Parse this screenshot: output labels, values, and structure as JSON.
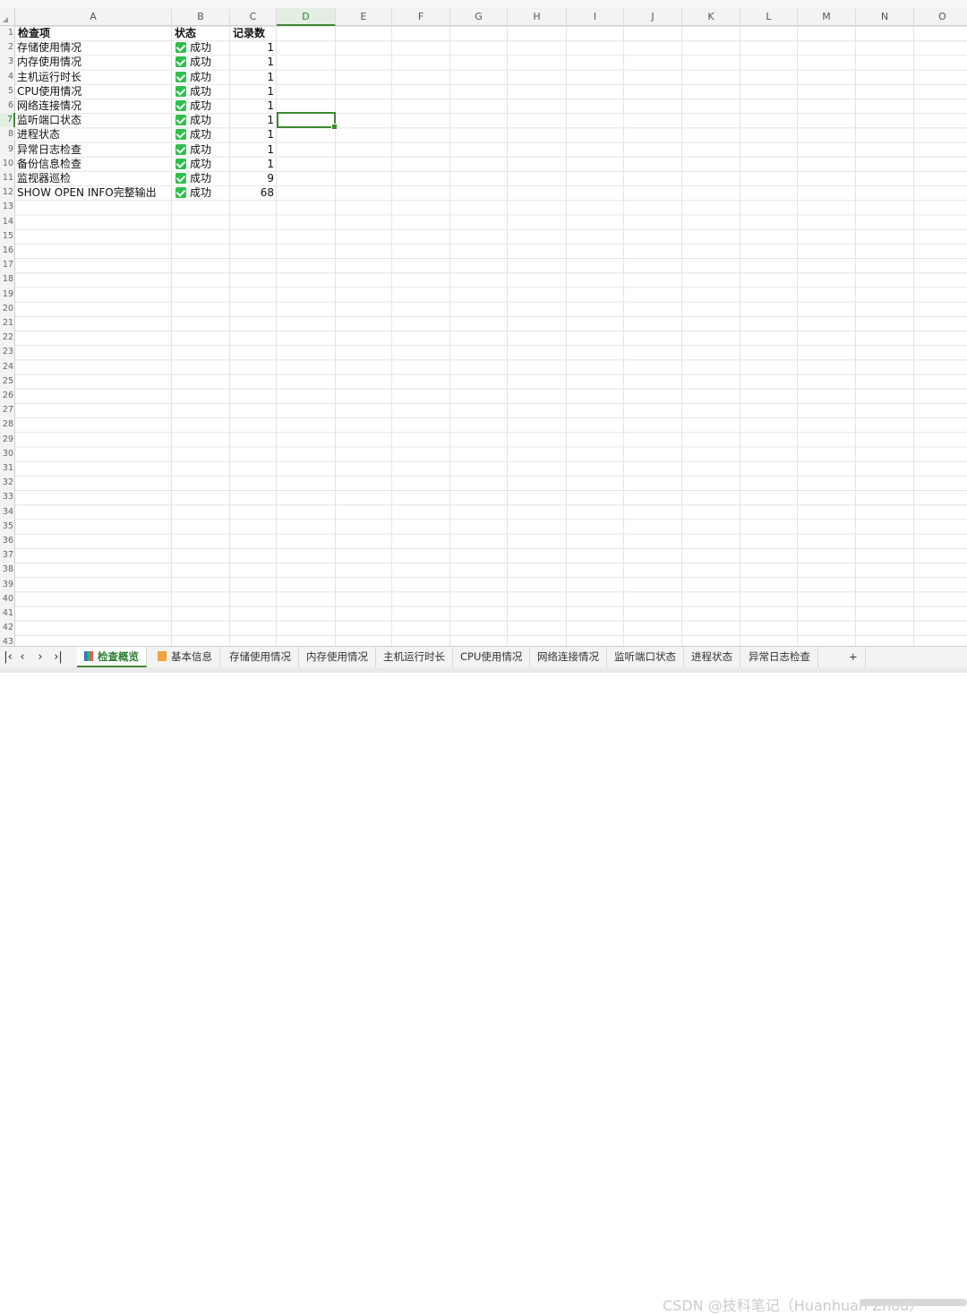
{
  "columns": [
    "A",
    "B",
    "C",
    "D",
    "E",
    "F",
    "G",
    "H",
    "I",
    "J",
    "K",
    "L",
    "M",
    "N",
    "O"
  ],
  "active_column": "D",
  "rows": [
    "1",
    "2",
    "3",
    "4",
    "5",
    "6",
    "7",
    "8",
    "9",
    "10",
    "11",
    "12",
    "13",
    "14",
    "15",
    "16",
    "17",
    "18",
    "19",
    "20",
    "21",
    "22",
    "23",
    "24",
    "25",
    "26",
    "27",
    "28",
    "29",
    "30",
    "31",
    "32",
    "33",
    "34",
    "35",
    "36",
    "37",
    "38",
    "39",
    "40",
    "41",
    "42",
    "43"
  ],
  "active_row": "7",
  "table": {
    "headers": [
      "检查项",
      "状态",
      "记录数"
    ],
    "rows": [
      {
        "item": "存储使用情况",
        "status": "成功",
        "count": "1"
      },
      {
        "item": "内存使用情况",
        "status": "成功",
        "count": "1"
      },
      {
        "item": "主机运行时长",
        "status": "成功",
        "count": "1"
      },
      {
        "item": "CPU使用情况",
        "status": "成功",
        "count": "1"
      },
      {
        "item": "网络连接情况",
        "status": "成功",
        "count": "1"
      },
      {
        "item": "监听端口状态",
        "status": "成功",
        "count": "1"
      },
      {
        "item": "进程状态",
        "status": "成功",
        "count": "1"
      },
      {
        "item": "异常日志检查",
        "status": "成功",
        "count": "1"
      },
      {
        "item": "备份信息检查",
        "status": "成功",
        "count": "1"
      },
      {
        "item": "监视器巡检",
        "status": "成功",
        "count": "9"
      },
      {
        "item": "SHOW OPEN INFO完整输出",
        "status": "成功",
        "count": "68"
      }
    ]
  },
  "tabs": [
    "检查概览",
    "基本信息",
    "存储使用情况",
    "内存使用情况",
    "主机运行时长",
    "CPU使用情况",
    "网络连接情况",
    "监听端口状态",
    "进程状态",
    "异常日志检查"
  ],
  "tabs_add": "+",
  "nav": {
    "first": "|‹",
    "prev": "‹",
    "next": "›",
    "last": "›|"
  },
  "watermark": "CSDN @技科笔记（Huanhuan Zhou）",
  "colors": {
    "accent": "#3b8b2e",
    "check": "#2fbf4d"
  }
}
